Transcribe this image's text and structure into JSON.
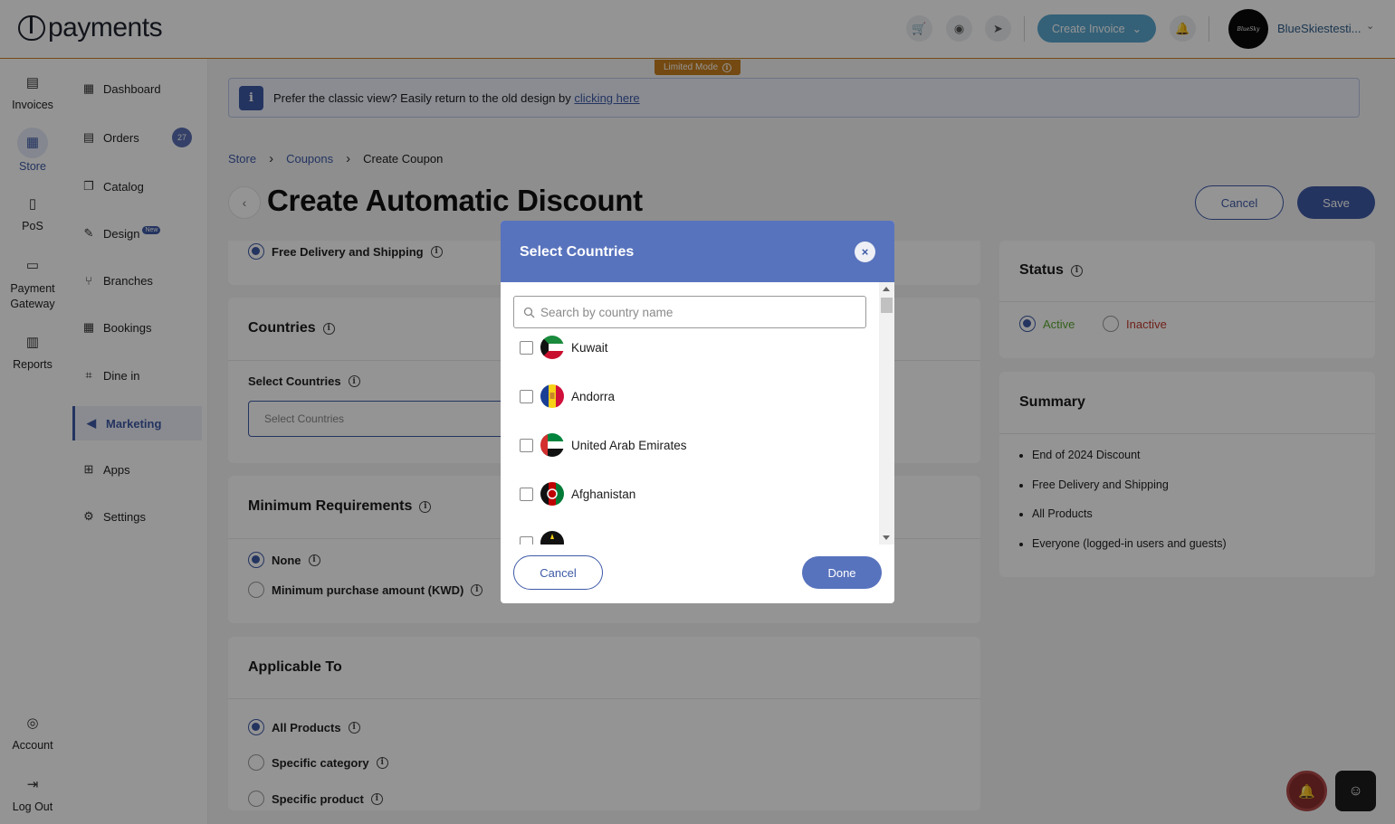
{
  "brand": {
    "name": "payments"
  },
  "topbar": {
    "create_invoice_label": "Create Invoice",
    "username": "BlueSkiestesti...",
    "avatar_text": "BlueSky",
    "limited_mode": "Limited Mode"
  },
  "rail": {
    "items": [
      {
        "label": "Invoices",
        "icon": "invoice-icon"
      },
      {
        "label": "Store",
        "icon": "store-icon"
      },
      {
        "label": "PoS",
        "icon": "pos-icon"
      },
      {
        "label": "Payment Gateway",
        "icon": "payment-gateway-icon"
      },
      {
        "label": "Reports",
        "icon": "reports-icon"
      },
      {
        "label": "Account",
        "icon": "account-icon"
      },
      {
        "label": "Log Out",
        "icon": "logout-icon"
      }
    ]
  },
  "subnav": {
    "items": [
      {
        "label": "Dashboard"
      },
      {
        "label": "Orders",
        "badge": "27"
      },
      {
        "label": "Catalog"
      },
      {
        "label": "Design",
        "tag": "New"
      },
      {
        "label": "Branches"
      },
      {
        "label": "Bookings"
      },
      {
        "label": "Dine in"
      },
      {
        "label": "Marketing"
      },
      {
        "label": "Apps"
      },
      {
        "label": "Settings"
      }
    ]
  },
  "banner": {
    "text": "Prefer the classic view? Easily return to the old design by",
    "link": "clicking here"
  },
  "breadcrumb": {
    "items": [
      "Store",
      "Coupons",
      "Create Coupon"
    ]
  },
  "page": {
    "title": "Create Automatic Discount",
    "cancel_label": "Cancel",
    "save_label": "Save"
  },
  "cards": {
    "free_delivery_label": "Free Delivery and Shipping",
    "countries_title": "Countries",
    "select_countries_label": "Select Countries",
    "select_countries_placeholder": "Select Countries",
    "min_req_title": "Minimum Requirements",
    "min_none": "None",
    "min_purchase": "Minimum purchase amount (KWD)",
    "applicable_title": "Applicable To",
    "all_products": "All Products",
    "specific_category": "Specific category",
    "specific_product": "Specific product",
    "status_title": "Status",
    "status_active": "Active",
    "status_inactive": "Inactive",
    "summary_title": "Summary",
    "summary_items": [
      "End of 2024 Discount",
      "Free Delivery and Shipping",
      "All Products",
      "Everyone (logged-in users and guests)"
    ]
  },
  "modal": {
    "title": "Select Countries",
    "search_placeholder": "Search by country name",
    "countries": [
      "Kuwait",
      "Andorra",
      "United Arab Emirates",
      "Afghanistan"
    ],
    "cancel_label": "Cancel",
    "done_label": "Done"
  },
  "colors": {
    "primary": "#3e5aa6",
    "modal_header": "#5873bd",
    "accent_orange": "#c9801f",
    "active_green": "#5aa830",
    "inactive_red": "#c0392b"
  }
}
